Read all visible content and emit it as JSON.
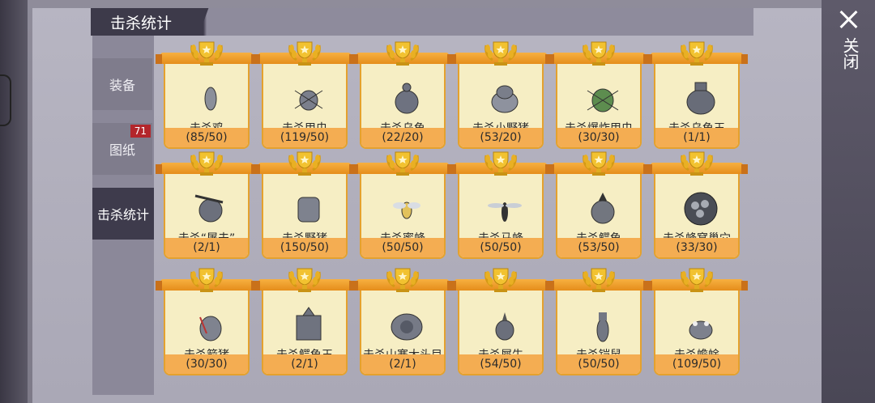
{
  "title": "击杀统计",
  "close_label": "关闭",
  "tabs": [
    {
      "label": "装备"
    },
    {
      "label": "图纸",
      "badge": "71"
    },
    {
      "label": "击杀统计"
    }
  ],
  "cards": [
    {
      "name": "击杀鸡",
      "count": "(85/50)",
      "icon": "chicken-icon"
    },
    {
      "name": "击杀甲虫",
      "count": "(119/50)",
      "icon": "beetle-icon"
    },
    {
      "name": "击杀乌龟",
      "count": "(22/20)",
      "icon": "turtle-icon"
    },
    {
      "name": "击杀小野猪",
      "count": "(53/20)",
      "icon": "piglet-icon"
    },
    {
      "name": "击杀爆炸甲虫",
      "count": "(30/30)",
      "icon": "bomb-beetle-icon"
    },
    {
      "name": "击杀乌龟王",
      "count": "(1/1)",
      "icon": "turtle-king-icon"
    },
    {
      "name": "击杀“屠夫”",
      "count": "(2/1)",
      "icon": "butcher-icon"
    },
    {
      "name": "击杀野猪",
      "count": "(150/50)",
      "icon": "boar-icon"
    },
    {
      "name": "击杀蜜蜂",
      "count": "(50/50)",
      "icon": "bee-icon"
    },
    {
      "name": "击杀马蜂",
      "count": "(50/50)",
      "icon": "wasp-icon"
    },
    {
      "name": "击杀鳄龟",
      "count": "(53/50)",
      "icon": "snapping-turtle-icon"
    },
    {
      "name": "击杀蜂窝巢穴",
      "count": "(33/30)",
      "icon": "hive-icon"
    },
    {
      "name": "击杀箭猪",
      "count": "(30/30)",
      "icon": "porcupine-icon"
    },
    {
      "name": "击杀鳄龟王",
      "count": "(2/1)",
      "icon": "snapping-turtle-king-icon"
    },
    {
      "name": "击杀山寨大头目",
      "count": "(2/1)",
      "icon": "bandit-chief-icon"
    },
    {
      "name": "击杀犀牛",
      "count": "(54/50)",
      "icon": "rhino-icon"
    },
    {
      "name": "击杀铠鼠",
      "count": "(50/50)",
      "icon": "armadillo-icon"
    },
    {
      "name": "击杀蟾蜍",
      "count": "(109/50)",
      "icon": "toad-icon"
    }
  ],
  "colors": {
    "card_bg": "#f6eec4",
    "card_border": "#e4a12e",
    "count_bar": "#f4ad52",
    "trophy": "#f2c230",
    "badge": "#b3262b",
    "active_tab": "#3e3b4c"
  }
}
